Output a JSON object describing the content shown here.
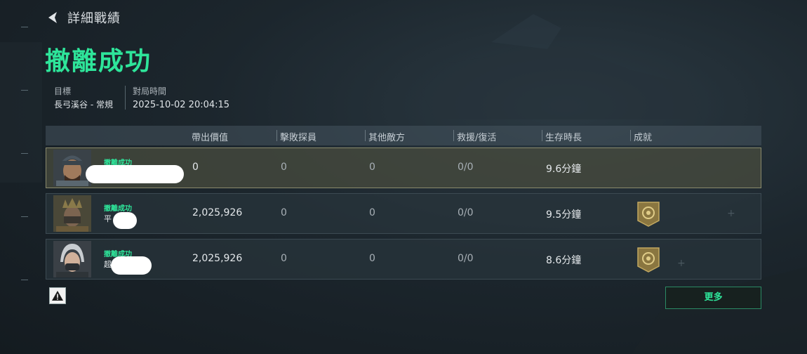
{
  "header": {
    "title": "詳細戰績"
  },
  "result_title": "撤離成功",
  "info": {
    "target_label": "目標",
    "target_value": "長弓溪谷 - 常規",
    "time_label": "對局時間",
    "time_value": "2025-10-02 20:04:15"
  },
  "columns": [
    "帶出價值",
    "擊敗探員",
    "其他敵方",
    "救援/復活",
    "生存時長",
    "成就"
  ],
  "rows": [
    {
      "status": "撤離成功",
      "name": "",
      "value": "0",
      "kills": "0",
      "others": "0",
      "rescue": "0/0",
      "survival": "9.6分鐘",
      "achievement": false
    },
    {
      "status": "撤離成功",
      "name": "平",
      "value": "2,025,926",
      "kills": "0",
      "others": "0",
      "rescue": "0/0",
      "survival": "9.5分鐘",
      "achievement": true
    },
    {
      "status": "撤離成功",
      "name": "超",
      "value": "2,025,926",
      "kills": "0",
      "others": "0",
      "rescue": "0/0",
      "survival": "8.6分鐘",
      "achievement": true
    }
  ],
  "buttons": {
    "more": "更多"
  },
  "icons": {
    "back": "back-arrow-icon",
    "warning": "warning-icon",
    "achievement": "achievement-badge-icon"
  },
  "colors": {
    "accent": "#2ee59a",
    "highlight_border": "#8a8a6c",
    "badge": "#a08a4a"
  }
}
